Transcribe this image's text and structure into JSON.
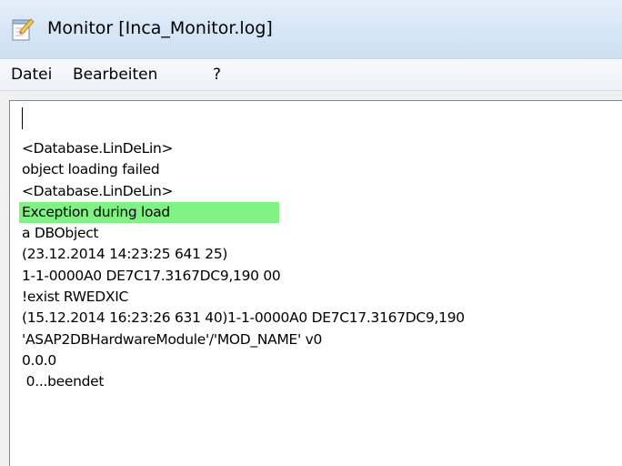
{
  "window": {
    "title": "Monitor [Inca_Monitor.log]",
    "icon": "notepad-pencil-icon"
  },
  "menu": {
    "items": [
      {
        "label": "Datei"
      },
      {
        "label": "Bearbeiten"
      },
      {
        "label": "?"
      }
    ]
  },
  "log": {
    "lines": [
      "<Database.LinDeLin>",
      "object loading failed",
      "<Database.LinDeLin>",
      "Exception during load",
      "a DBObject",
      "(23.12.2014 14:23:25 641 25)",
      "1-1-0000A0 DE7C17.3167DC9,190 00",
      "!exist RWEDXIC",
      "(15.12.2014 16:23:26 631 40)1-1-0000A0 DE7C17.3167DC9,190",
      "'ASAP2DBHardwareModule'/'MOD_NAME' v0",
      "0.0.0",
      " 0...beendet"
    ],
    "highlight_line_index": 3,
    "highlight_color": "#7ff283"
  }
}
